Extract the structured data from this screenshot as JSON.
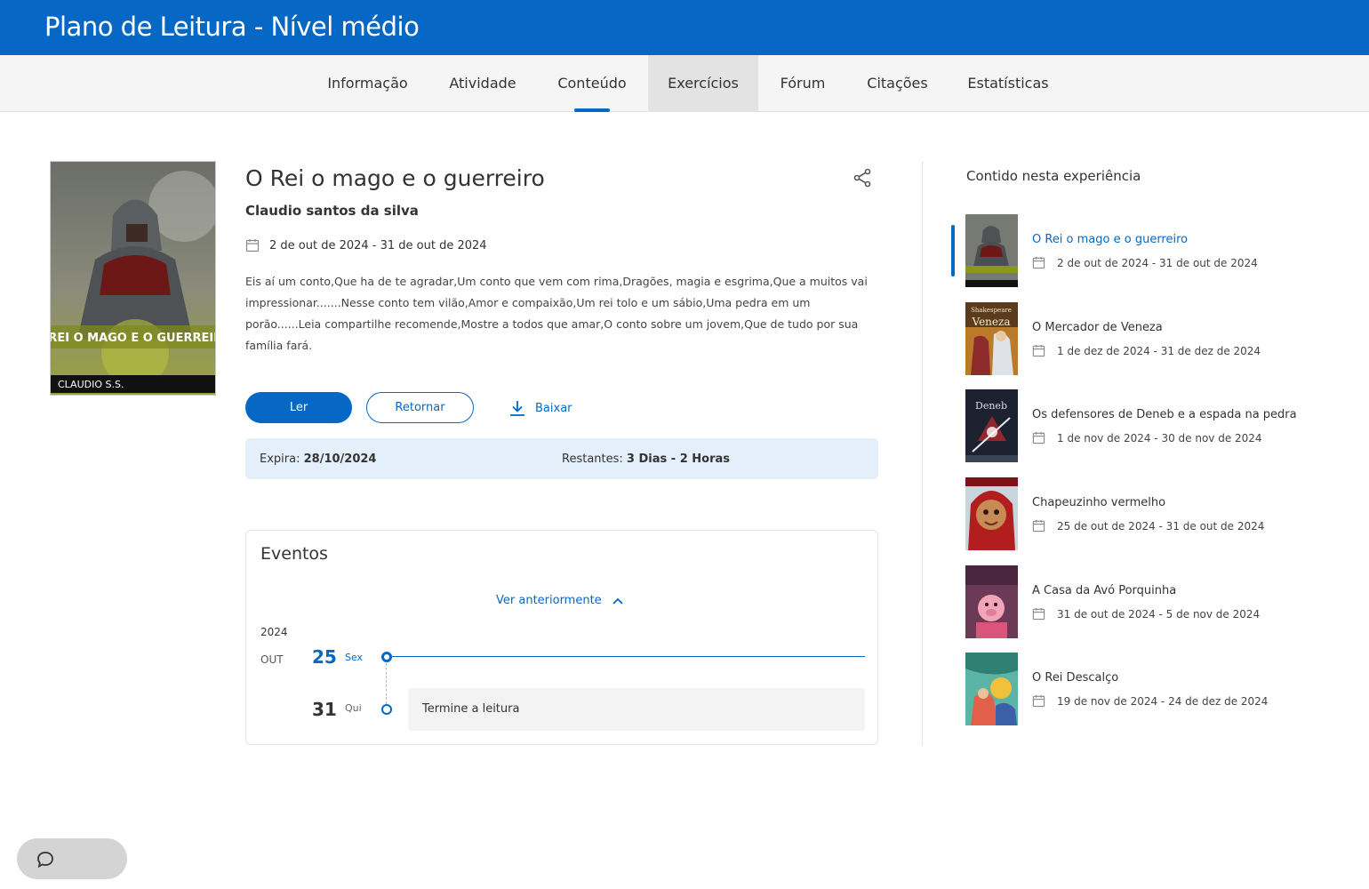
{
  "header": {
    "title": "Plano de Leitura - Nível médio"
  },
  "tabs": [
    {
      "label": "Informação"
    },
    {
      "label": "Atividade"
    },
    {
      "label": "Conteúdo"
    },
    {
      "label": "Exercícios"
    },
    {
      "label": "Fórum"
    },
    {
      "label": "Citações"
    },
    {
      "label": "Estatísticas"
    }
  ],
  "active_tab": "Conteúdo",
  "hovered_tab": "Exercícios",
  "book": {
    "cover_title": "O REI O MAGO E O GUERREIRO",
    "cover_author": "CLAUDIO S.S.",
    "title": "O Rei o mago e o guerreiro",
    "author": "Claudio santos da silva",
    "dates": "2 de out de 2024 - 31 de out de 2024",
    "description": "Eis aí um conto,Que ha de te agradar,Um conto que vem com rima,Dragões, magia e esgrima,Que a muitos vai impressionar.......Nesse conto tem vilão,Amor e compaixão,Um rei tolo e um sábio,Uma pedra em um porão......Leia compartilhe recomende,Mostre a todos que amar,O conto sobre um jovem,Que de tudo por sua família fará."
  },
  "actions": {
    "read_label": "Ler",
    "return_label": "Retornar",
    "download_label": "Baixar"
  },
  "expiry": {
    "expires_label": "Expira:",
    "expires_value": "28/10/2024",
    "remaining_label": "Restantes:",
    "remaining_value": "3 Dias - 2 Horas"
  },
  "events": {
    "title": "Eventos",
    "see_previous": "Ver anteriormente",
    "year": "2024",
    "month": "OUT",
    "items": [
      {
        "day": "25",
        "weekday": "Sex"
      },
      {
        "day": "31",
        "weekday": "Qui",
        "task": "Termine a leitura"
      }
    ]
  },
  "sidebar": {
    "heading": "Contido nesta experiência",
    "items": [
      {
        "title": "O Rei o mago e o guerreiro",
        "dates": "2 de out de 2024 - 31 de out de 2024",
        "active": true
      },
      {
        "title": "O Mercador de Veneza",
        "dates": "1 de dez de 2024 - 31 de dez de 2024",
        "thumb_text_top": "Shakespeare",
        "thumb_text": "Veneza"
      },
      {
        "title": "Os defensores de Deneb e a espada na pedra",
        "dates": "1 de nov de 2024 - 30 de nov de 2024",
        "thumb_text": "Deneb"
      },
      {
        "title": "Chapeuzinho vermelho",
        "dates": "25 de out de 2024 - 31 de out de 2024"
      },
      {
        "title": "A Casa da Avó Porquinha",
        "dates": "31 de out de 2024 - 5 de nov de 2024"
      },
      {
        "title": "O Rei Descalço",
        "dates": "19 de nov de 2024 - 24 de dez de 2024"
      }
    ]
  },
  "colors": {
    "brand": "#0668c4",
    "expiry_bg": "#e3effb"
  }
}
